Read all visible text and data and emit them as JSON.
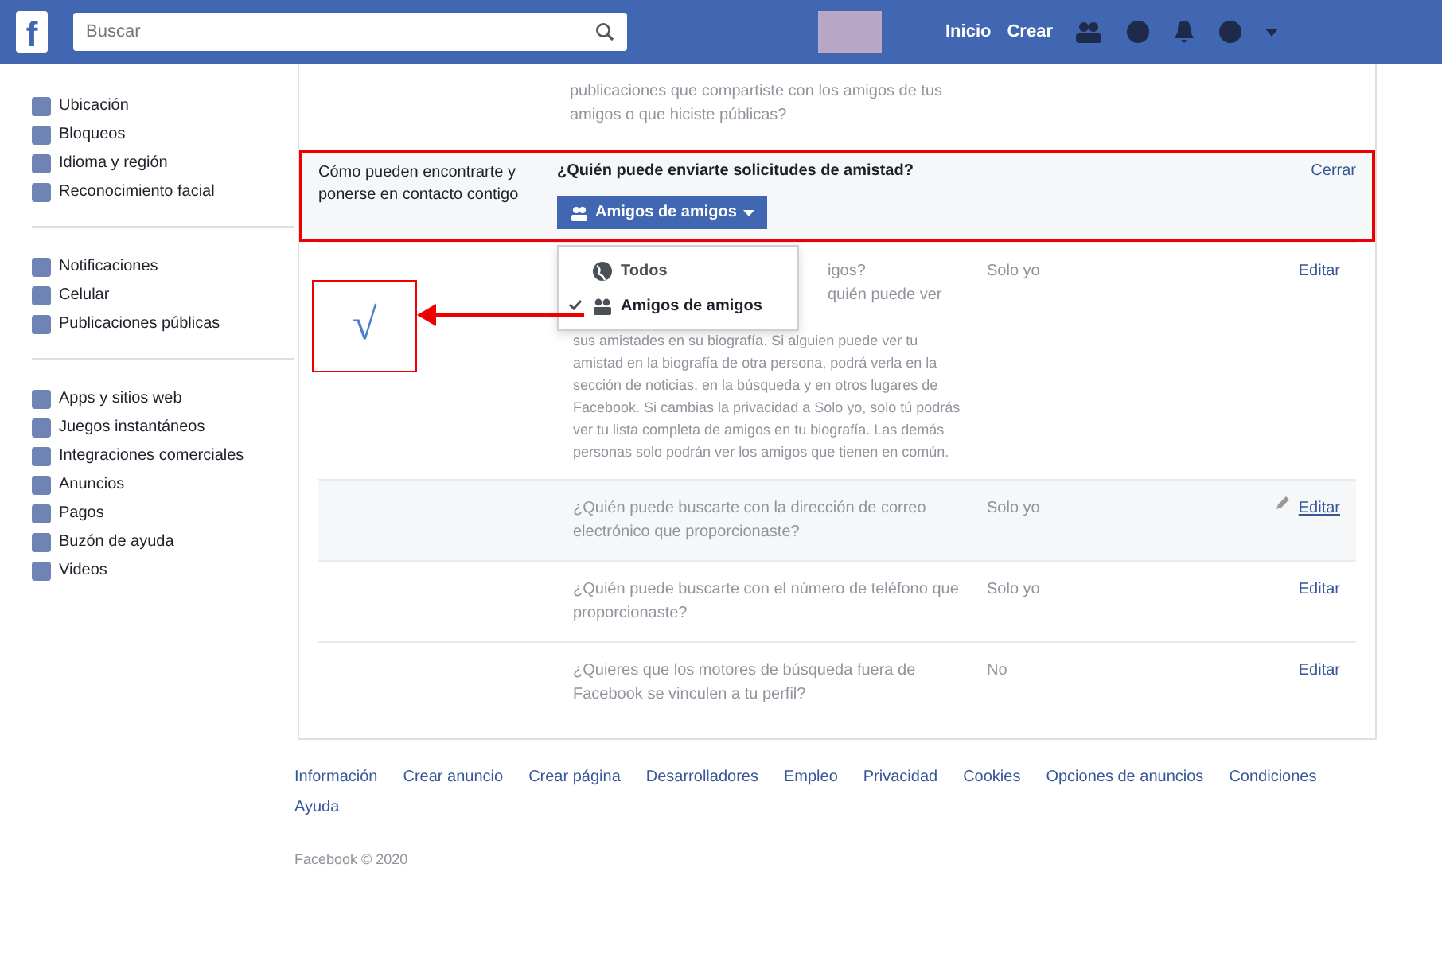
{
  "header": {
    "logo": "f",
    "search": {
      "placeholder": "Buscar"
    },
    "nav": [
      "Inicio",
      "Crear"
    ]
  },
  "sidebar": {
    "groups": [
      [
        {
          "label": "Ubicación"
        },
        {
          "label": "Bloqueos"
        },
        {
          "label": "Idioma y región"
        },
        {
          "label": "Reconocimiento facial"
        }
      ],
      [
        {
          "label": "Notificaciones"
        },
        {
          "label": "Celular"
        },
        {
          "label": "Publicaciones públicas"
        }
      ],
      [
        {
          "label": "Apps y sitios web"
        },
        {
          "label": "Juegos instantáneos"
        },
        {
          "label": "Integraciones comerciales"
        },
        {
          "label": "Anuncios"
        },
        {
          "label": "Pagos"
        },
        {
          "label": "Buzón de ayuda"
        },
        {
          "label": "Videos"
        }
      ]
    ]
  },
  "settings": {
    "top_text": "publicaciones que compartiste con los amigos de tus amigos o que hiciste públicas?",
    "section_label": "Cómo pueden encontrarte y ponerse en contacto contigo",
    "open_row": {
      "question": "¿Quién puede enviarte solicitudes de amistad?",
      "button": "Amigos de amigos",
      "action": "Cerrar",
      "menu": [
        {
          "label": "Todos",
          "kind": "public",
          "selected": false
        },
        {
          "label": "Amigos de amigos",
          "kind": "friends",
          "selected": true
        }
      ]
    },
    "rows": [
      {
        "question": "igos?",
        "description_fragment": "quién puede ver",
        "description": "sus amistades en su biografía. Si alguien puede ver tu amistad en la biografía de otra persona, podrá verla en la sección de noticias, en la búsqueda y en otros lugares de Facebook. Si cambias la privacidad a Solo yo, solo tú podrás ver tu lista completa de amigos en tu biografía. Las demás personas solo podrán ver los amigos que tienen en común.",
        "value": "Solo yo",
        "action": "Editar",
        "highlighted": false
      },
      {
        "question": "¿Quién puede buscarte con la dirección de correo electrónico que proporcionaste?",
        "value": "Solo yo",
        "action": "Editar",
        "highlighted": true
      },
      {
        "question": "¿Quién puede buscarte con el número de teléfono que proporcionaste?",
        "value": "Solo yo",
        "action": "Editar",
        "highlighted": false
      },
      {
        "question": "¿Quieres que los motores de búsqueda fuera de Facebook se vinculen a tu perfil?",
        "value": "No",
        "action": "Editar",
        "highlighted": false
      }
    ]
  },
  "annotation": {
    "mark": "√"
  },
  "footer": {
    "links": [
      "Información",
      "Crear anuncio",
      "Crear página",
      "Desarrolladores",
      "Empleo",
      "Privacidad",
      "Cookies",
      "Opciones de anuncios",
      "Condiciones",
      "Ayuda"
    ],
    "copyright": "Facebook © 2020"
  }
}
